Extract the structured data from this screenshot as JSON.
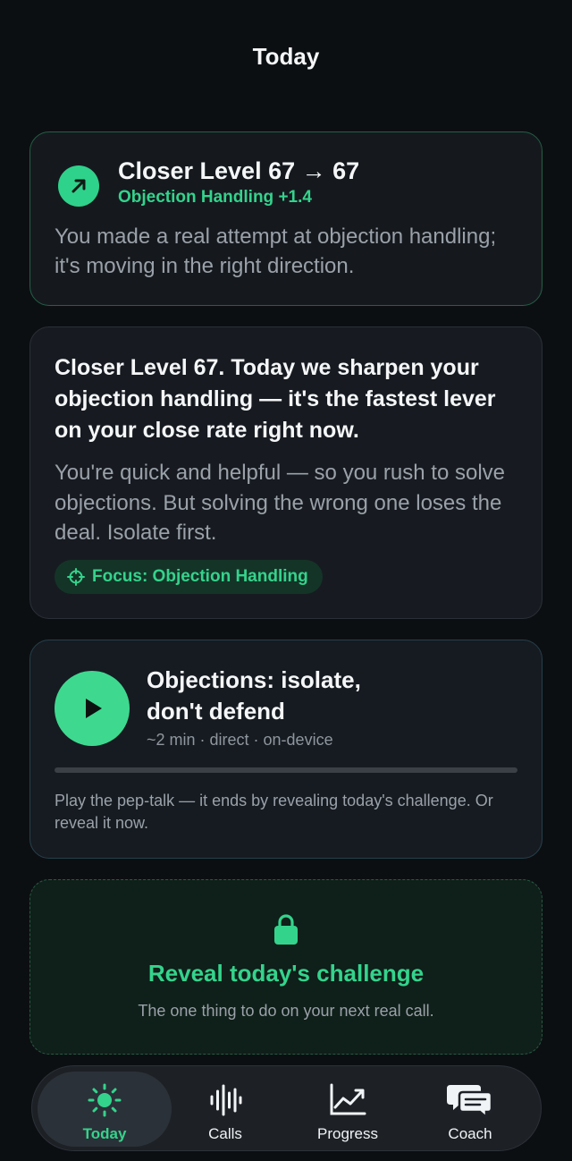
{
  "header": {
    "title": "Today"
  },
  "level_card": {
    "title": "Closer Level 67 → 67",
    "subtitle": "Objection Handling +1.4",
    "body": "You made a real attempt at objection handling; it's moving in the right direction."
  },
  "message_card": {
    "headline": "Closer Level 67. Today we sharpen your objection handling — it's the fastest lever on your close rate right now.",
    "body": "You're quick and helpful — so you rush to solve objections. But solving the wrong one loses the deal. Isolate first.",
    "focus_chip": "Focus: Objection Handling"
  },
  "player_card": {
    "title": "Objections: isolate, don't defend",
    "meta": "~2 min · direct · on-device",
    "progress": 0,
    "note": "Play the pep-talk — it ends by revealing today's challenge. Or reveal it now."
  },
  "reveal_card": {
    "title": "Reveal today's challenge",
    "subtitle": "The one thing to do on your next real call."
  },
  "tabs": [
    {
      "label": "Today",
      "icon": "sun-icon",
      "active": true
    },
    {
      "label": "Calls",
      "icon": "waveform-icon",
      "active": false
    },
    {
      "label": "Progress",
      "icon": "chart-icon",
      "active": false
    },
    {
      "label": "Coach",
      "icon": "chat-icon",
      "active": false
    }
  ],
  "colors": {
    "accent": "#34d38c",
    "background": "#0c0f12",
    "card": "#171b21"
  }
}
